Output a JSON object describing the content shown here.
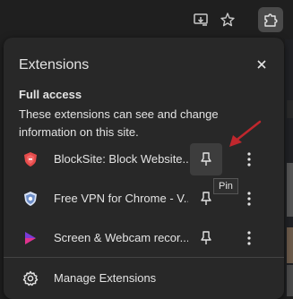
{
  "toolbar": {
    "buttons": [
      {
        "name": "cast-icon"
      },
      {
        "name": "bookmark-star-icon"
      },
      {
        "name": "extensions-puzzle-icon"
      }
    ]
  },
  "panel": {
    "title": "Extensions",
    "close_icon": "close-icon",
    "section_heading": "Full access",
    "section_desc": "These extensions can see and change information on this site.",
    "extensions": [
      {
        "name": "BlockSite: Block Website...",
        "icon": "shield-icon",
        "icon_color": "#e54b4b"
      },
      {
        "name": "Free VPN for Chrome - V...",
        "icon": "vpn-shield-icon",
        "icon_color": "#8fa8d8"
      },
      {
        "name": "Screen & Webcam recor...",
        "icon": "screen-recorder-icon",
        "icon_color": "#7a3cd6"
      }
    ],
    "manage_label": "Manage Extensions",
    "tooltip": "Pin"
  },
  "colors": {
    "panel_bg": "#282828",
    "page_bg": "#1f1f1f",
    "text": "#e3e3e3",
    "arrow": "#c0272d"
  }
}
